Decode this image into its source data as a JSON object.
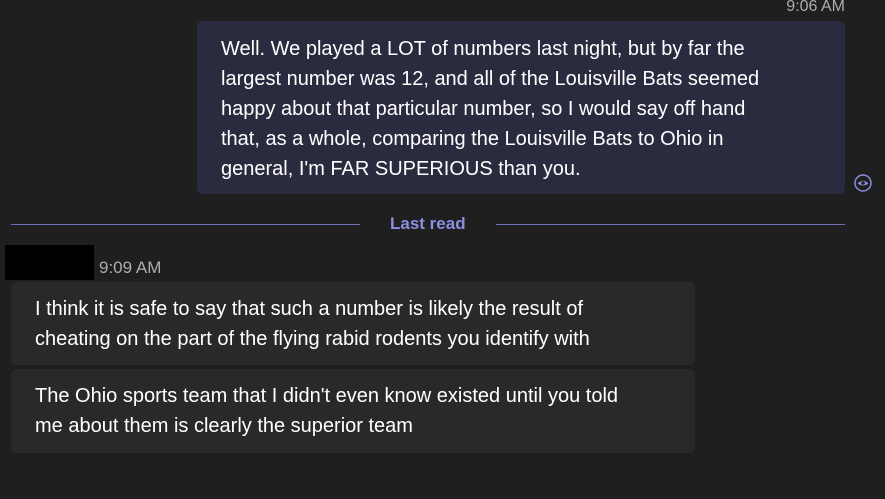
{
  "sent_message": {
    "timestamp": "9:06 AM",
    "lines": [
      "Well.  We played a LOT of numbers last night, but by far the",
      "largest number was 12, and all of the Louisville Bats seemed",
      "happy about that particular number, so I would say off hand",
      "that, as a whole, comparing the Louisville Bats to Ohio in",
      "general, I'm FAR SUPERIOUS than you."
    ],
    "read_receipt_icon": "eye-icon"
  },
  "divider": {
    "label": "Last read"
  },
  "received_messages": {
    "timestamp": "9:09 AM",
    "messages": [
      {
        "lines": [
          "I think it is safe to say that such a number is likely the result of",
          "cheating on the part of the flying rabid rodents you identify with"
        ]
      },
      {
        "lines": [
          "The Ohio sports team that I didn't even know existed until you told",
          "me about them is clearly the superior team"
        ]
      }
    ]
  },
  "colors": {
    "background": "#1f1f1f",
    "sent_bubble": "#2b2b40",
    "received_bubble": "#292929",
    "accent": "#8b8de0",
    "timestamp": "#adadad"
  }
}
